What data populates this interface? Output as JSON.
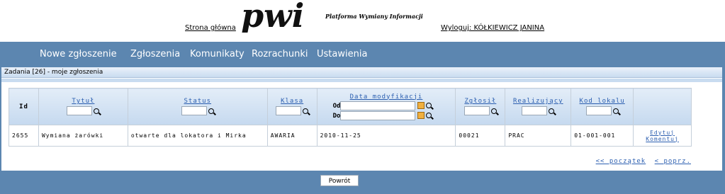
{
  "header": {
    "home_link": "Strona główna",
    "logo_mark": "pwi",
    "logo_tagline": "Platforma Wymiany Informacji",
    "logout_link": "Wyloguj: KÓŁKIEWICZ JANINA"
  },
  "nav": {
    "items": [
      "Nowe zgłoszenie",
      "Zgłoszenia",
      "Komunikaty",
      "Rozrachunki",
      "Ustawienia"
    ]
  },
  "panel": {
    "title": "Zadania [26] - moje zgłoszenia"
  },
  "table": {
    "columns": {
      "id": "Id",
      "tytul": "Tytuł",
      "status": "Status",
      "klasa": "Klasa",
      "data_modyfikacji": "Data modyfikacji",
      "zglosil": "Zgłosił",
      "realizujacy": "Realizujący",
      "kod_lokalu": "Kod lokalu"
    },
    "date_filter": {
      "from_label": "Od",
      "to_label": "Do"
    },
    "rows": [
      {
        "id": "2655",
        "tytul": "Wymiana żarówki",
        "status": "otwarte dla lokatora i Mirka",
        "klasa": "AWARIA",
        "data": "2010-11-25",
        "zglosil": "00021",
        "realizujacy": "PRAC",
        "kod_lokalu": "01-001-001",
        "edit": "Edytuj",
        "comment": "Komentuj"
      }
    ]
  },
  "pager": {
    "first": "<< początek",
    "prev": "< poprz."
  },
  "footer": {
    "back_button": "Powrót"
  },
  "colors": {
    "bar": "#5c86b0",
    "link": "#2c5fb0"
  }
}
